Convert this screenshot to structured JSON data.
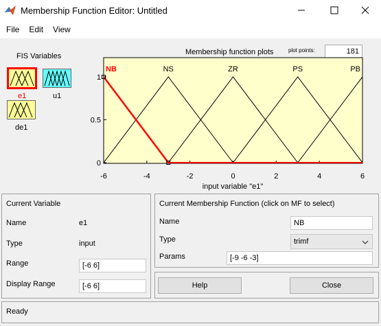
{
  "window": {
    "title": "Membership Function Editor: Untitled"
  },
  "menu": {
    "file": "File",
    "edit": "Edit",
    "view": "View"
  },
  "fis": {
    "heading": "FIS Variables",
    "vars": [
      {
        "name": "e1",
        "color": "#ffff99",
        "selected": true
      },
      {
        "name": "u1",
        "color": "#66ffff",
        "selected": false
      },
      {
        "name": "de1",
        "color": "#ffff99",
        "selected": false
      }
    ]
  },
  "plot": {
    "title": "Membership function plots",
    "points_label": "plot points:",
    "points_value": "181",
    "xlabel": "input variable \"e1\"",
    "mf_names": [
      "NB",
      "NS",
      "ZR",
      "PS",
      "PB"
    ],
    "x_ticks": [
      "-6",
      "-4",
      "-2",
      "0",
      "2",
      "4",
      "6"
    ],
    "y_ticks": [
      "0",
      "0.5",
      "1"
    ]
  },
  "chart_data": {
    "type": "line",
    "xlim": [
      -6,
      6
    ],
    "ylim": [
      0,
      1
    ],
    "background": "#ffffcc",
    "selected_color": "#ff0000",
    "series": [
      {
        "name": "NB",
        "x": [
          -9,
          -6,
          -3
        ],
        "y": [
          0,
          1,
          0
        ],
        "selected": true
      },
      {
        "name": "NS",
        "x": [
          -6,
          -3,
          0
        ],
        "y": [
          0,
          1,
          0
        ],
        "selected": false
      },
      {
        "name": "ZR",
        "x": [
          -3,
          0,
          3
        ],
        "y": [
          0,
          1,
          0
        ],
        "selected": false
      },
      {
        "name": "PS",
        "x": [
          0,
          3,
          6
        ],
        "y": [
          0,
          1,
          0
        ],
        "selected": false
      },
      {
        "name": "PB",
        "x": [
          3,
          6,
          9
        ],
        "y": [
          0,
          1,
          0
        ],
        "selected": false
      }
    ]
  },
  "current_variable": {
    "heading": "Current Variable",
    "name_label": "Name",
    "name_value": "e1",
    "type_label": "Type",
    "type_value": "input",
    "range_label": "Range",
    "range_value": "[-6 6]",
    "display_range_label": "Display Range",
    "display_range_value": "[-6 6]"
  },
  "current_mf": {
    "heading": "Current Membership Function (click on MF to select)",
    "name_label": "Name",
    "name_value": "NB",
    "type_label": "Type",
    "type_value": "trimf",
    "params_label": "Params",
    "params_value": "[-9 -6 -3]"
  },
  "buttons": {
    "help": "Help",
    "close": "Close"
  },
  "status": {
    "text": "Ready"
  }
}
